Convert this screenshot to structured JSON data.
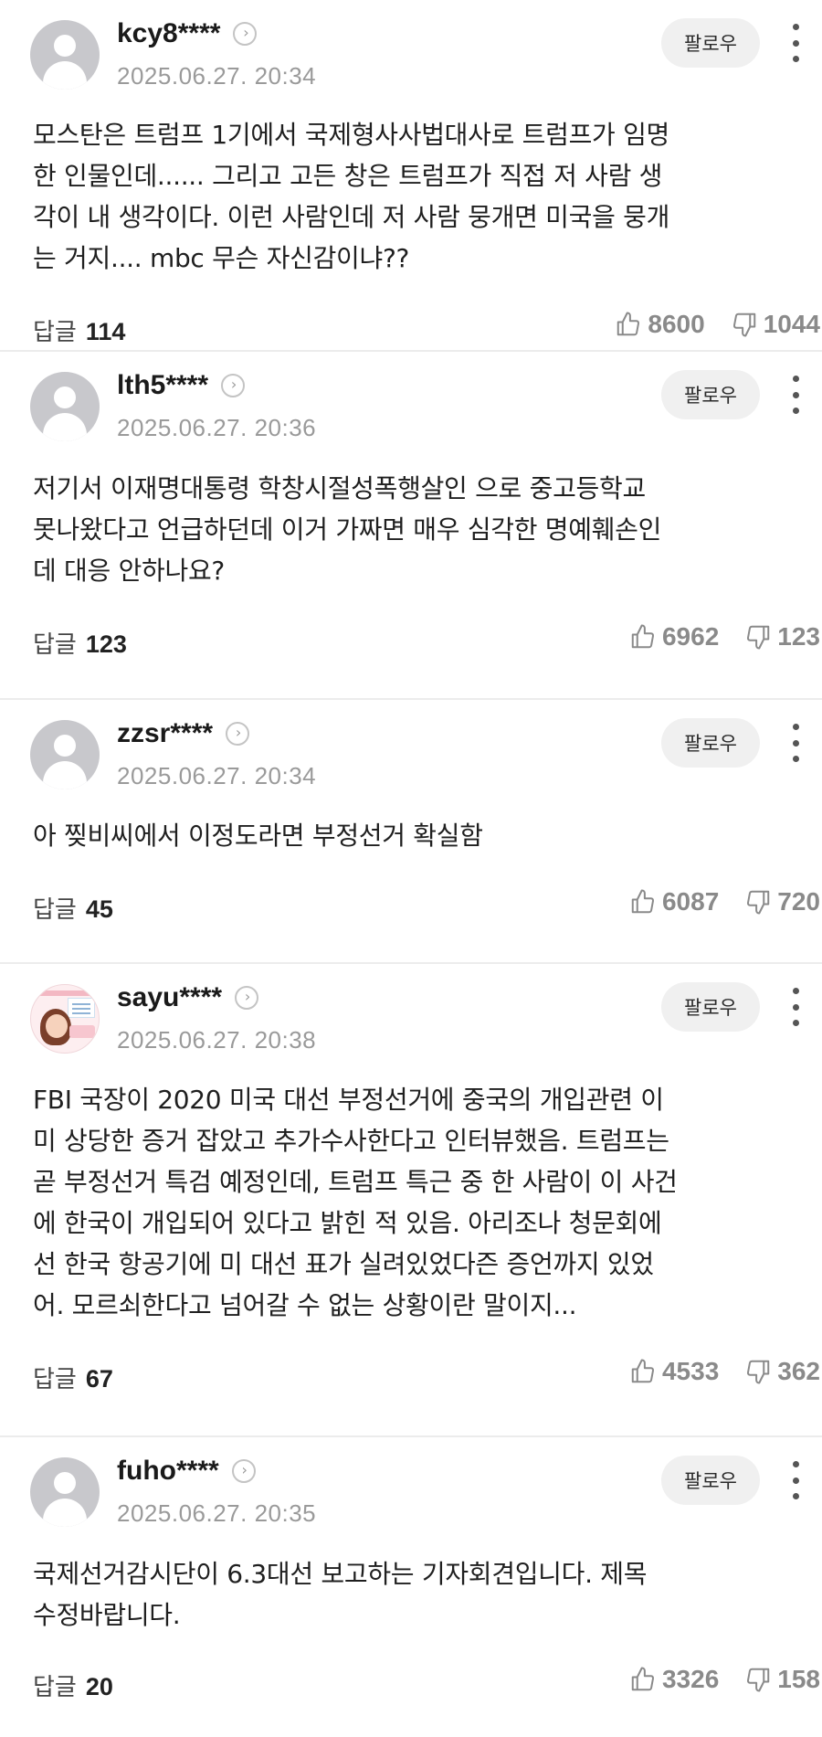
{
  "actions": {
    "follow_label": "팔로우",
    "reply_label": "답글"
  },
  "comments": [
    {
      "nickname": "kcy8****",
      "date": "2025.06.27. 20:34",
      "text": "모스탄은 트럼프 1기에서 국제형사사법대사로 트럼프가 임명\n한 인물인데...... 그리고 고든 창은 트럼프가 직접 저 사람 생\n각이 내 생각이다. 이런 사람인데 저 사람 뭉개면 미국을 뭉개\n는 거지.... mbc 무슨 자신감이냐??",
      "replies": "114",
      "likes": "8600",
      "dislikes": "1044",
      "avatar": "default-avatar"
    },
    {
      "nickname": "lth5****",
      "date": "2025.06.27. 20:36",
      "text": "저기서 이재명대통령 학창시절성폭행살인 으로 중고등학교\n못나왔다고 언급하던데 이거 가짜면 매우 심각한 명예훼손인\n데 대응 안하나요?",
      "replies": "123",
      "likes": "6962",
      "dislikes": "123",
      "avatar": "default-avatar"
    },
    {
      "nickname": "zzsr****",
      "date": "2025.06.27. 20:34",
      "text": "아 찢비씨에서 이정도라면 부정선거 확실함",
      "replies": "45",
      "likes": "6087",
      "dislikes": "720",
      "avatar": "default-avatar"
    },
    {
      "nickname": "sayu****",
      "date": "2025.06.27. 20:38",
      "text": "FBI 국장이 2020 미국 대선 부정선거에 중국의 개입관련 이\n미 상당한 증거 잡았고 추가수사한다고 인터뷰했음. 트럼프는\n곧 부정선거 특검 예정인데, 트럼프 특근 중 한 사람이 이 사건\n에 한국이 개입되어 있다고 밝힌 적 있음. 아리조나 청문회에\n선 한국 항공기에 미 대선 표가 실려있었다즌 증언까지 있었\n어. 모르쇠한다고 넘어갈 수 없는 상황이란 말이지...",
      "replies": "67",
      "likes": "4533",
      "dislikes": "362",
      "avatar": "custom-avatar"
    },
    {
      "nickname": "fuho****",
      "date": "2025.06.27. 20:35",
      "text": "국제선거감시단이 6.3대선 보고하는 기자회견입니다. 제목\n수정바랍니다.",
      "replies": "20",
      "likes": "3326",
      "dislikes": "158",
      "avatar": "default-avatar"
    }
  ]
}
